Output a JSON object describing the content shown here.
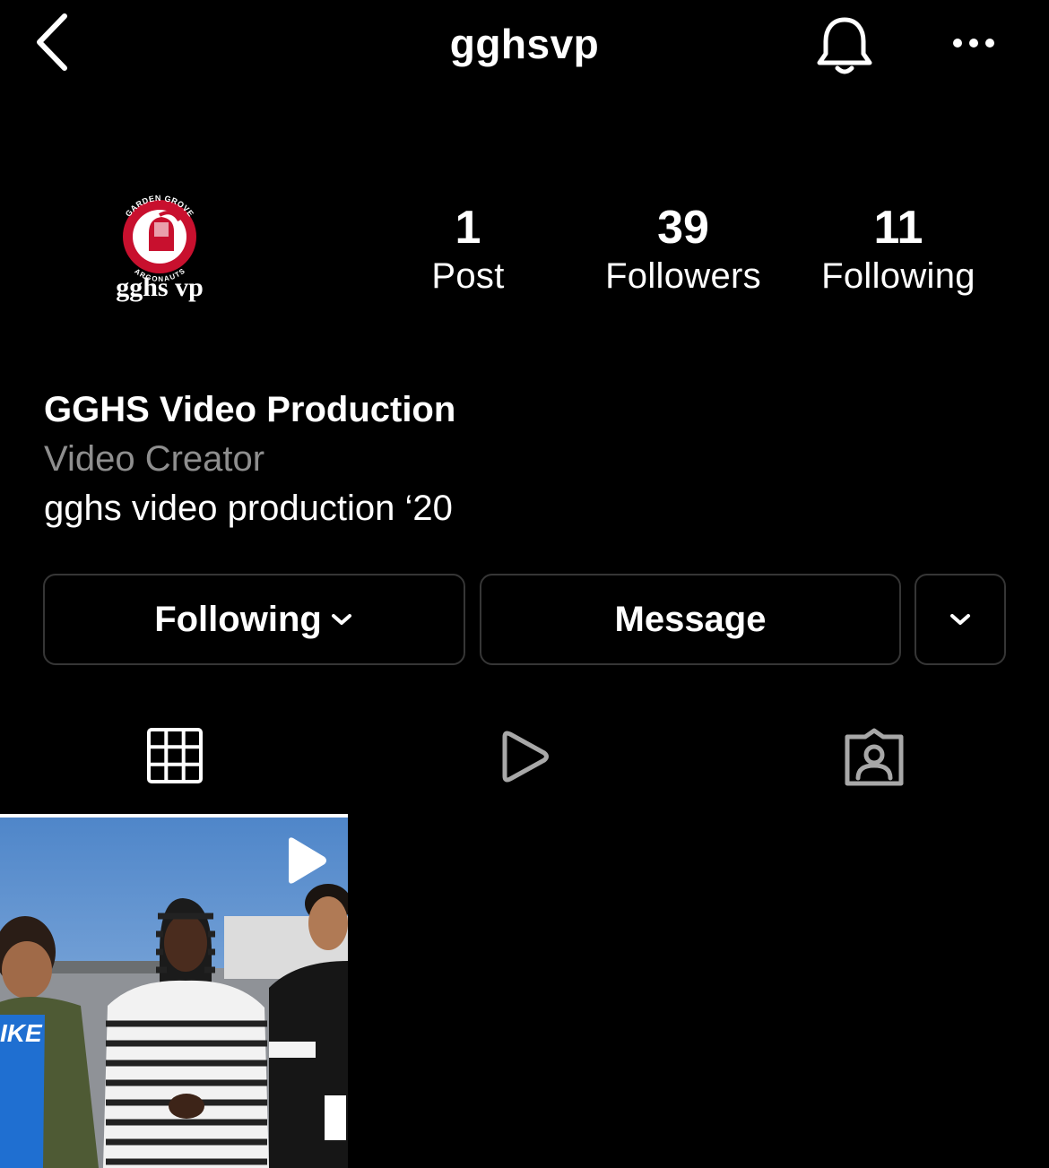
{
  "header": {
    "username": "gghsvp",
    "icons": [
      "chevron-left-icon",
      "bell-icon",
      "more-icon"
    ]
  },
  "profile": {
    "avatar_text_top": "GARDEN GROVE",
    "avatar_text_bottom": "ARGONAUTS",
    "avatar_caption": "gghs vp",
    "stats": {
      "posts": {
        "count": "1",
        "label": "Post"
      },
      "followers": {
        "count": "39",
        "label": "Followers"
      },
      "following": {
        "count": "11",
        "label": "Following"
      }
    },
    "name": "GGHS Video Production",
    "category": "Video Creator",
    "bio": "gghs video production ‘20"
  },
  "actions": {
    "following_label": "Following",
    "message_label": "Message"
  },
  "tabs": [
    {
      "icon": "grid-icon",
      "active": true
    },
    {
      "icon": "reels-icon",
      "active": false
    },
    {
      "icon": "tagged-icon",
      "active": false
    }
  ],
  "posts": [
    {
      "type": "reel",
      "icon": "play-icon"
    }
  ],
  "colors": {
    "background": "#000000",
    "text": "#ffffff",
    "secondary_text": "#8e8e8e",
    "button_border": "#363636",
    "avatar_red": "#c8102e"
  }
}
